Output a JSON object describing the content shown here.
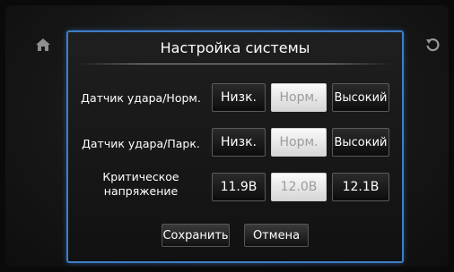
{
  "header": {
    "home_icon": "home-icon",
    "back_icon": "refresh-back-icon"
  },
  "dialog": {
    "title": "Настройка системы",
    "rows": [
      {
        "label": "Датчик удара/Норм.",
        "options": [
          "Низк.",
          "Норм.",
          "Высокий"
        ],
        "selected": "Норм."
      },
      {
        "label": "Датчик удара/Парк.",
        "options": [
          "Низк.",
          "Норм.",
          "Высокий"
        ],
        "selected": "Норм."
      },
      {
        "label_line1": "Критическое",
        "label_line2": "напряжение",
        "options": [
          "11.9В",
          "12.0В",
          "12.1В"
        ],
        "selected": "12.0В"
      }
    ],
    "save_label": "Сохранить",
    "cancel_label": "Отмена"
  }
}
